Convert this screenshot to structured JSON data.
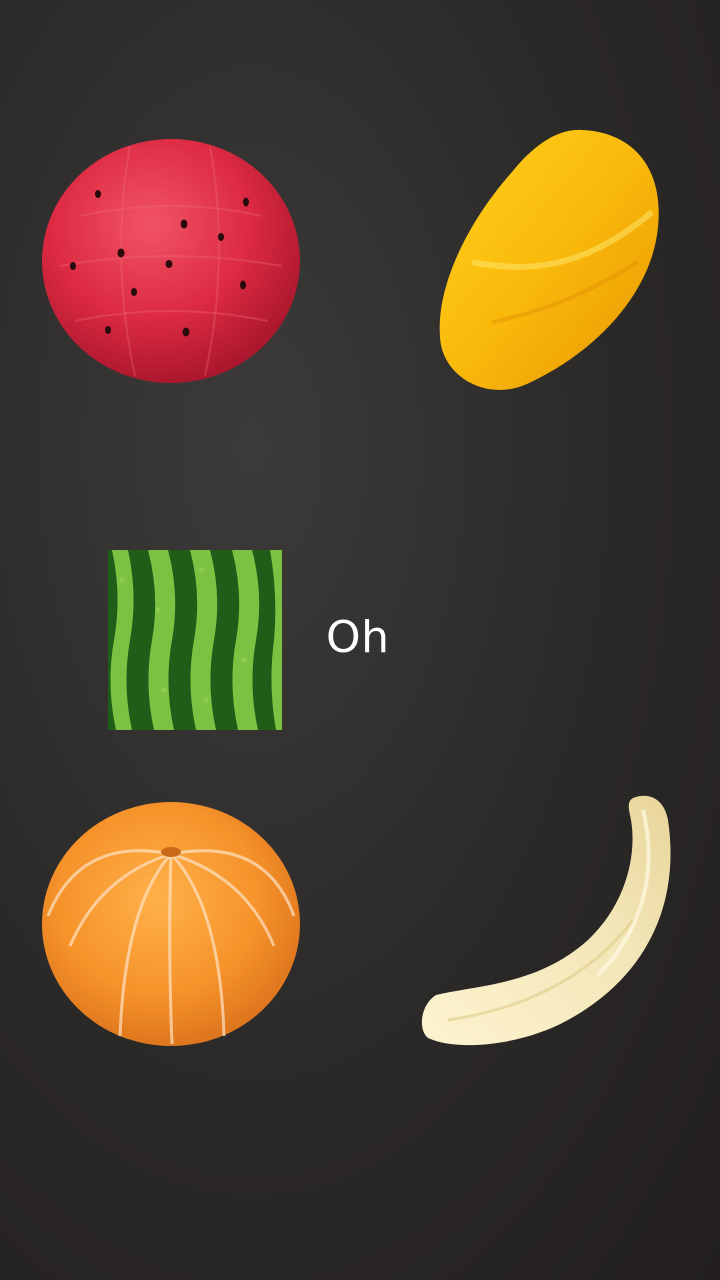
{
  "screen": {
    "caption": "Oh"
  },
  "items": [
    {
      "name": "watermelon-fruit",
      "icon": "watermelon-ball-icon",
      "color": "#e0324a"
    },
    {
      "name": "mango-fruit",
      "icon": "peeled-mango-icon",
      "color": "#f7b90f"
    },
    {
      "name": "watermelon-rind-tile",
      "icon": "watermelon-stripe-icon",
      "color": "#2f7a22"
    },
    {
      "name": "mandarin-fruit",
      "icon": "peeled-mandarin-icon",
      "color": "#f5952c"
    },
    {
      "name": "banana-fruit",
      "icon": "peeled-banana-icon",
      "color": "#f3e7bd"
    }
  ]
}
